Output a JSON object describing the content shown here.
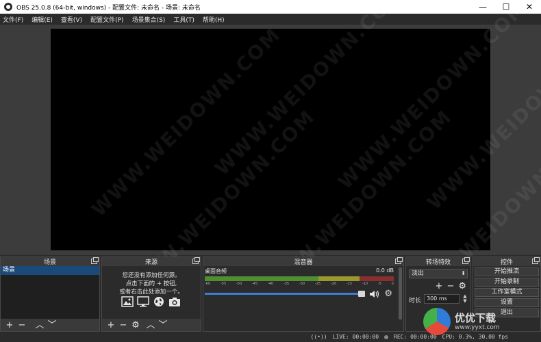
{
  "window": {
    "title": "OBS 25.0.8 (64-bit, windows) - 配置文件: 未命名 - 场景: 未命名",
    "minimize": "—",
    "maximize": "☐",
    "close": "✕"
  },
  "menu": [
    "文件(F)",
    "编辑(E)",
    "查看(V)",
    "配置文件(P)",
    "场景集合(S)",
    "工具(T)",
    "帮助(H)"
  ],
  "watermark": "WWW.WEIDOWN.COM",
  "docks": {
    "scenes": {
      "title": "场景",
      "items": [
        "场景"
      ]
    },
    "sources": {
      "title": "来源",
      "empty_line1": "您还没有添加任何源。",
      "empty_line2": "点击下面的 + 按钮,",
      "empty_line3": "或者右击此处添加一个。"
    },
    "mixer": {
      "title": "混音器",
      "track_name": "桌面音频",
      "level": "0.0 dB",
      "scale": [
        "-60",
        "-55",
        "-50",
        "-45",
        "-40",
        "-35",
        "-30",
        "-25",
        "-20",
        "-15",
        "-10",
        "-5",
        "0"
      ]
    },
    "transitions": {
      "title": "转场特效",
      "selected": "淡出",
      "duration_label": "时长",
      "duration_value": "300 ms"
    },
    "controls": {
      "title": "控件",
      "start_stream": "开始推流",
      "start_record": "开始录制",
      "studio_mode": "工作室模式",
      "settings": "设置",
      "exit": "退出"
    }
  },
  "toolbar": {
    "add": "+",
    "remove": "−",
    "up": "︿",
    "down": "﹀",
    "gear": "⚙"
  },
  "status": {
    "live": "LIVE: 00:00:00",
    "rec": "REC: 00:00:00",
    "cpu": "CPU: 0.3%, 30.00 fps"
  },
  "corner_logo": {
    "text": "优优下载",
    "sub": "www.yyxt.com"
  }
}
